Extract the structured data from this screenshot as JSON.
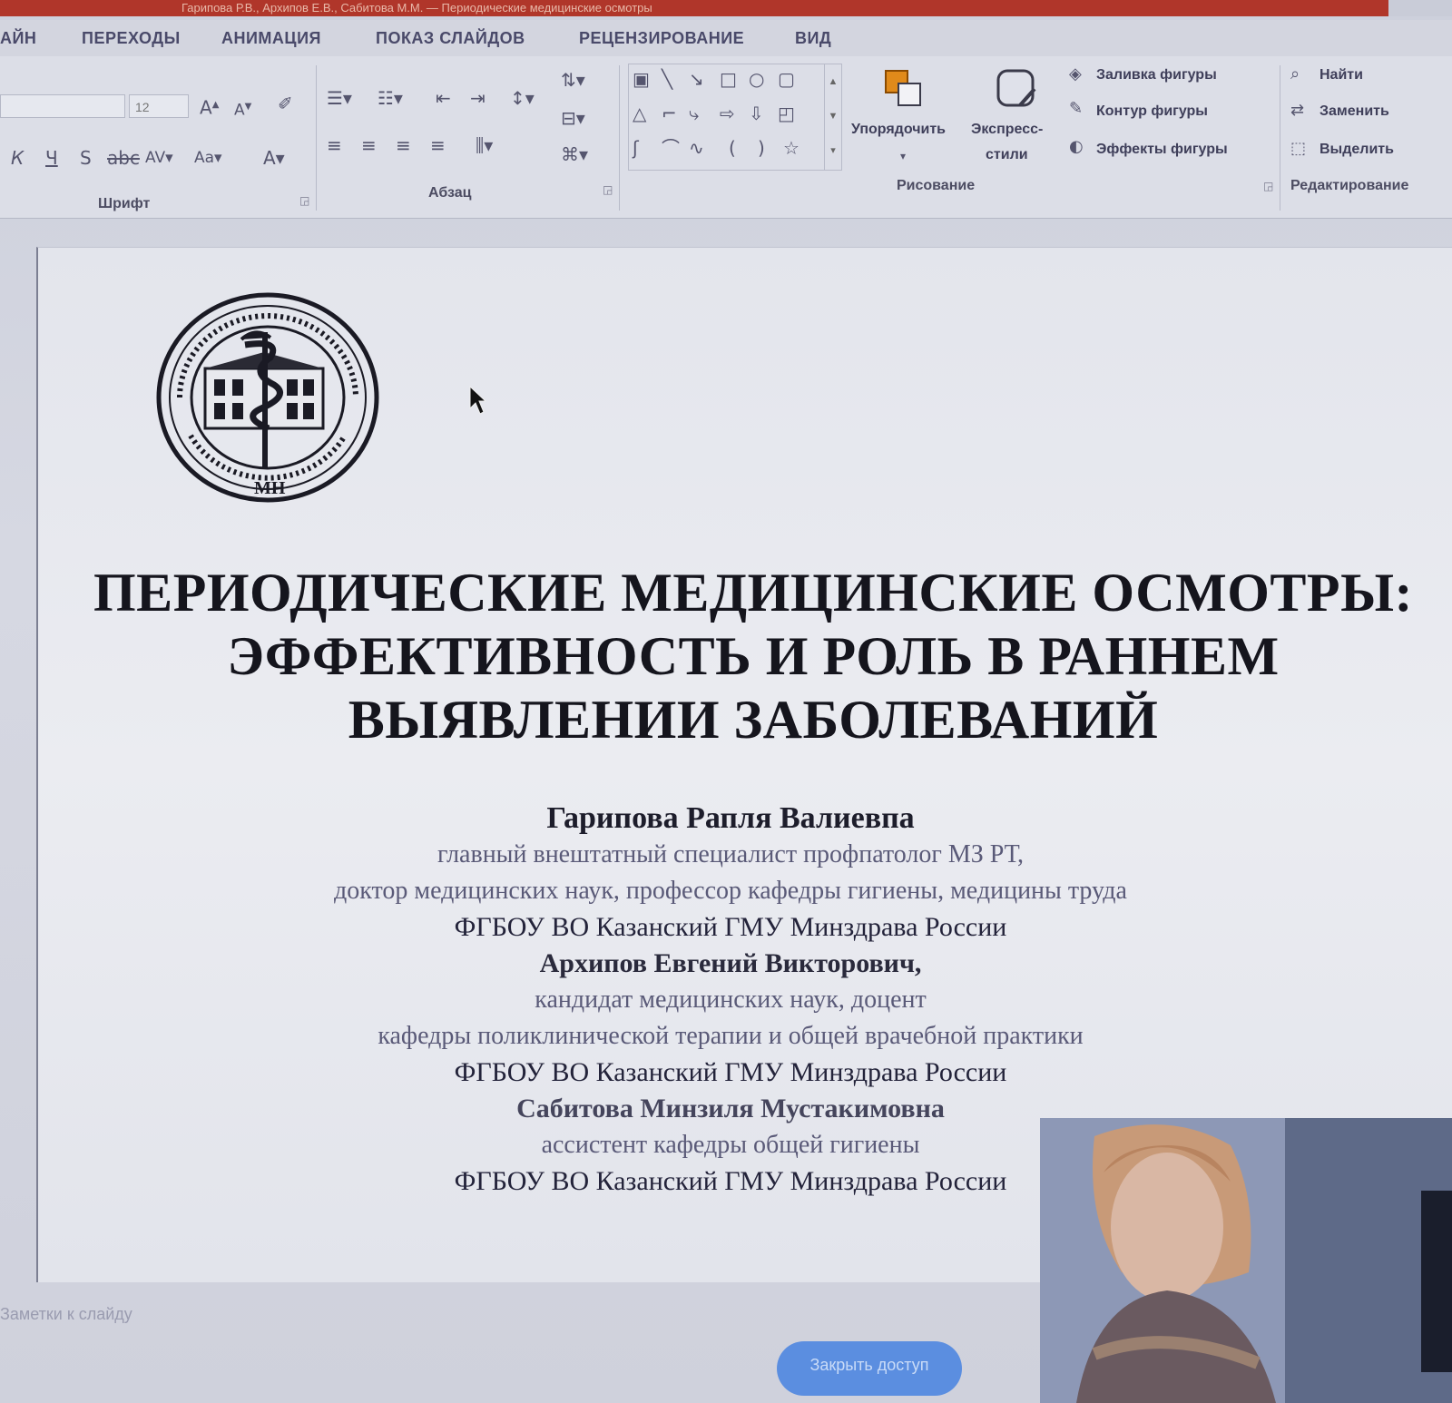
{
  "window": {
    "title": "Гарипова Р.В., Архипов Е.В., Сабитова М.М. — Периодические медицинские осмотры"
  },
  "ribbon": {
    "tabs": [
      "АЙН",
      "ПЕРЕХОДЫ",
      "АНИМАЦИЯ",
      "ПОКАЗ СЛАЙДОВ",
      "РЕЦЕНЗИРОВАНИЕ",
      "ВИД"
    ],
    "font_group": {
      "label": "Шрифт",
      "font_size": "12"
    },
    "paragraph_group": {
      "label": "Абзац"
    },
    "drawing_group": {
      "label": "Рисование",
      "arrange": "Упорядочить",
      "quick_styles_line1": "Экспресс-",
      "quick_styles_line2": "стили",
      "shape_fill": "Заливка фигуры",
      "shape_outline": "Контур фигуры",
      "shape_effects": "Эффекты фигуры"
    },
    "editing_group": {
      "label": "Редактирование",
      "find": "Найти",
      "replace": "Заменить",
      "select": "Выделить"
    }
  },
  "slide": {
    "title_lines": [
      "ПЕРИОДИЧЕСКИЕ МЕДИЦИНСКИЕ ОСМОТРЫ:",
      "ЭФФЕКТИВНОСТЬ И РОЛЬ В РАННЕМ",
      "ВЫЯВЛЕНИИ ЗАБОЛЕВАНИЙ"
    ],
    "authors": [
      {
        "name": "Гарипова Рапля Валиевпа",
        "roles": [
          "главный внештатный специалист профпатолог МЗ РТ,",
          "доктор медицинских наук, профессор кафедры гигиены, медицины труда"
        ],
        "org": "ФГБОУ ВО Казанский ГМУ Минздрава России"
      },
      {
        "name": "Архипов Евгений Викторович,",
        "roles": [
          "кандидат медицинских наук, доцент",
          "кафедры поликлинической терапии и общей врачебной практики"
        ],
        "org": "ФГБОУ ВО Казанский ГМУ Минздрава России"
      },
      {
        "name": "Сабитова Минзиля Мустакимовна",
        "roles": [
          "ассистент кафедры общей гигиены"
        ],
        "org": "ФГБОУ ВО Казанский ГМУ Минздрава России"
      }
    ],
    "seal_text": "МН"
  },
  "footer": {
    "notes_label": "Заметки к слайду",
    "stop_share_label": "Закрыть доступ"
  },
  "colors": {
    "accent_titlebar": "#b0362a",
    "stop_share_button": "#5b8ee0"
  }
}
